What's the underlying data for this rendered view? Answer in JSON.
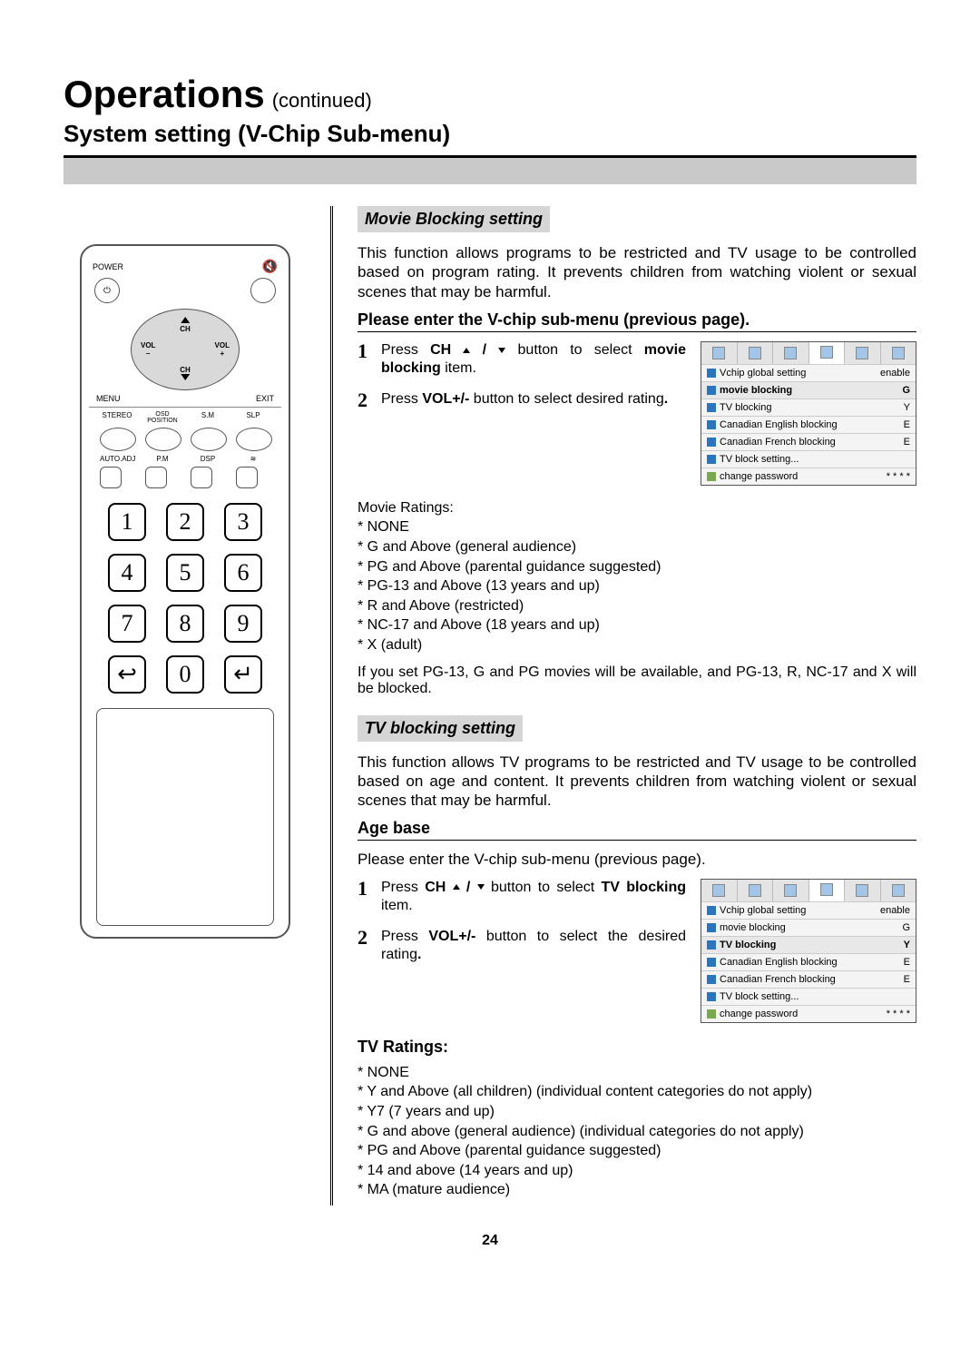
{
  "title": {
    "main": "Operations",
    "cont": "(continued)"
  },
  "subtitle": "System setting (V-Chip Sub-menu)",
  "remote": {
    "power": "POWER",
    "menu": "MENU",
    "exit": "EXIT",
    "dpad_ch": "CH",
    "dpad_vol": "VOL",
    "row1_labels": [
      "STEREO",
      "OSD\nPOSITION",
      "S.M",
      "SLP"
    ],
    "row2_labels": [
      "AUTO.ADJ",
      "P.M",
      "DSP",
      ""
    ],
    "keys": [
      "1",
      "2",
      "3",
      "4",
      "5",
      "6",
      "7",
      "8",
      "9",
      "↩",
      "0",
      "↵"
    ]
  },
  "movie": {
    "heading": "Movie Blocking setting",
    "intro": "This function allows programs to be restricted and TV usage to be controlled based on program rating. It prevents children from watching violent or sexual scenes that may be harmful.",
    "enter": "Please enter the V-chip sub-menu (previous page).",
    "step1_a": "Press ",
    "step1_b": "CH",
    "step1_c": " button to select ",
    "step1_d": "movie blocking",
    "step1_e": " item.",
    "step2_a": "Press ",
    "step2_b": "VOL+/-",
    "step2_c": " button to select desired rating",
    "step2_d": ".",
    "ratings_title": "Movie Ratings:",
    "ratings": [
      "* NONE",
      "* G and Above (general audience)",
      "* PG and Above (parental guidance suggested)",
      "* PG-13 and Above (13 years and up)",
      "* R and Above (restricted)",
      "* NC-17 and Above (18 years and up)",
      "* X (adult)"
    ],
    "note": "If you set PG-13, G and PG movies will be available,  and PG-13, R, NC-17 and X will be blocked."
  },
  "osd1": {
    "rows": [
      {
        "label": "Vchip global setting",
        "val": "enable"
      },
      {
        "label": "movie blocking",
        "val": "G",
        "hl": true
      },
      {
        "label": "TV blocking",
        "val": "Y"
      },
      {
        "label": "Canadian English blocking",
        "val": "E"
      },
      {
        "label": "Canadian French blocking",
        "val": "E"
      },
      {
        "label": "TV block setting...",
        "val": ""
      },
      {
        "label": "change password",
        "val": "* * * *"
      }
    ]
  },
  "tv": {
    "heading": "TV blocking setting",
    "intro": "This function allows TV programs to be restricted and TV usage to be controlled based on age and content. It prevents children from watching violent or sexual scenes that may be harmful.",
    "agebase": "Age base",
    "enter": "Please enter the V-chip sub-menu (previous page).",
    "step1_a": "Press ",
    "step1_b": "CH",
    "step1_c": " button to select ",
    "step1_d": "TV blocking",
    "step1_e": " item.",
    "step2_a": "Press ",
    "step2_b": "VOL+/-",
    "step2_c": " button to select the desired rating",
    "step2_d": ".",
    "ratings_title": "TV Ratings:",
    "ratings": [
      "* NONE",
      "* Y and Above (all children) (individual content categories do not apply)",
      "* Y7 (7 years and up)",
      "* G and above (general audience) (individual categories do not apply)",
      "* PG and Above (parental guidance suggested)",
      "* 14 and above (14 years and up)",
      "* MA  (mature audience)"
    ]
  },
  "osd2": {
    "rows": [
      {
        "label": "Vchip global setting",
        "val": "enable"
      },
      {
        "label": "movie blocking",
        "val": "G"
      },
      {
        "label": "TV blocking",
        "val": "Y",
        "hl": true
      },
      {
        "label": "Canadian English blocking",
        "val": "E"
      },
      {
        "label": "Canadian French blocking",
        "val": "E"
      },
      {
        "label": "TV block setting...",
        "val": ""
      },
      {
        "label": "change password",
        "val": "* * * *"
      }
    ]
  },
  "pagenum": "24"
}
